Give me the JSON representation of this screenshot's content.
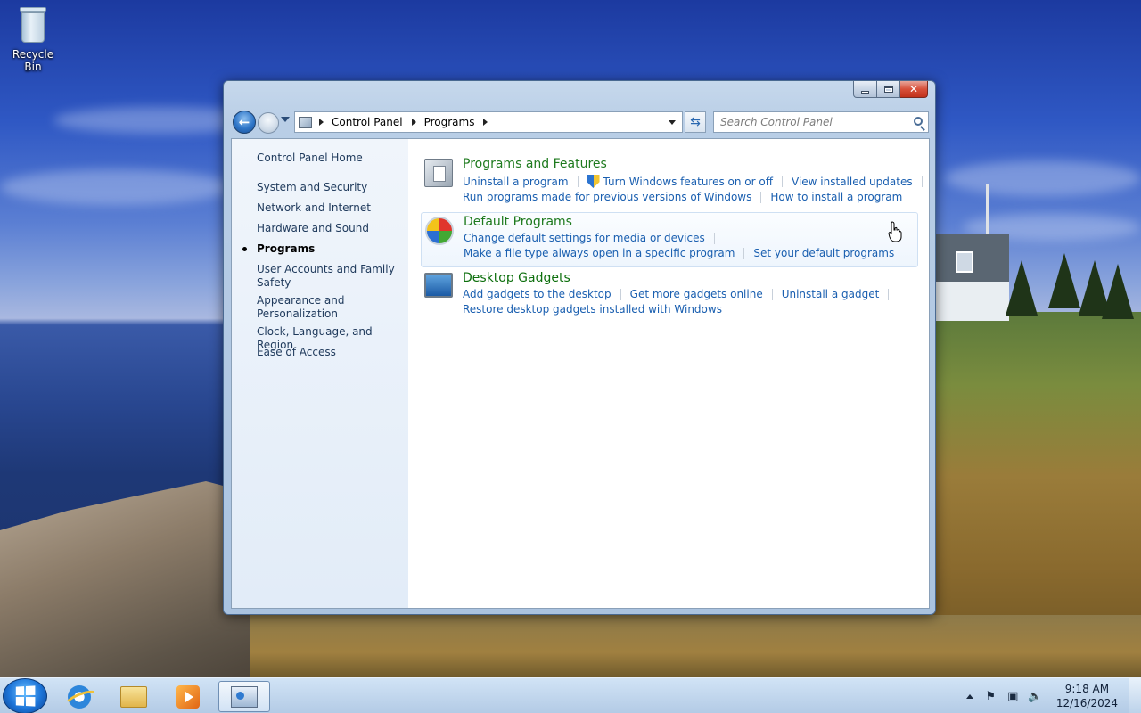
{
  "desktop": {
    "icons": [
      {
        "label": "Recycle Bin",
        "icon": "recycle-bin-icon"
      }
    ]
  },
  "window": {
    "caption_buttons": {
      "minimize": "minimize",
      "maximize": "maximize",
      "close": "✕"
    },
    "nav": {
      "breadcrumb": [
        "Control Panel",
        "Programs"
      ],
      "search_placeholder": "Search Control Panel"
    },
    "left_pane": {
      "items": [
        "Control Panel Home",
        "System and Security",
        "Network and Internet",
        "Hardware and Sound",
        "Programs",
        "User Accounts and Family Safety",
        "Appearance and Personalization",
        "Clock, Language, and Region",
        "Ease of Access"
      ],
      "active_index": 4
    },
    "categories": {
      "programs_features": {
        "title": "Programs and Features",
        "links": [
          "Uninstall a program",
          "Turn Windows features on or off",
          "View installed updates",
          "Run programs made for previous versions of Windows",
          "How to install a program"
        ]
      },
      "default_programs": {
        "title": "Default Programs",
        "links": [
          "Change default settings for media or devices",
          "Make a file type always open in a specific program",
          "Set your default programs"
        ]
      },
      "desktop_gadgets": {
        "title": "Desktop Gadgets",
        "links": [
          "Add gadgets to the desktop",
          "Get more gadgets online",
          "Uninstall a gadget",
          "Restore desktop gadgets installed with Windows"
        ]
      }
    }
  },
  "taskbar": {
    "pinned": [
      "internet-explorer-icon",
      "windows-explorer-icon",
      "media-player-icon",
      "control-panel-icon"
    ],
    "clock": {
      "time": "9:18 AM",
      "date": "12/16/2024"
    }
  },
  "colors": {
    "link": "#1a5fb0",
    "category_title": "#1e7a1e",
    "left_pane_text": "#1e395b"
  }
}
